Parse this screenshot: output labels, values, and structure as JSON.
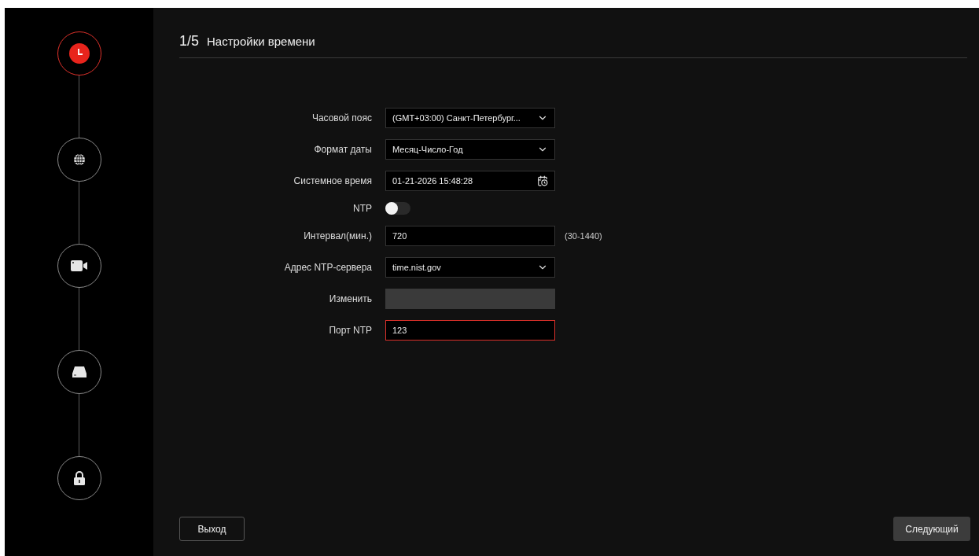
{
  "steps": [
    {
      "selected": true
    },
    {
      "selected": false
    },
    {
      "selected": false
    },
    {
      "selected": false
    },
    {
      "selected": false
    }
  ],
  "header": {
    "step": "1/5",
    "title": "Настройки времени"
  },
  "form": [
    {
      "label": "Часовой пояс",
      "kind": "select",
      "value": "(GMT+03:00) Санкт-Петербург...",
      "focused": false
    },
    {
      "label": "Формат даты",
      "kind": "select",
      "value": "Месяц-Число-Год",
      "focused": false
    },
    {
      "label": "Системное время",
      "kind": "date",
      "value": "01-21-2026 15:48:28",
      "focused": false
    },
    {
      "label": "NTP",
      "kind": "toggle",
      "on": false
    },
    {
      "label": "Интервал(мин.)",
      "kind": "input",
      "value": "720",
      "hint": "(30-1440)",
      "focused": false
    },
    {
      "label": "Адрес NTP-сервера",
      "kind": "select",
      "value": "time.nist.gov",
      "focused": false
    },
    {
      "label": "Изменить",
      "kind": "disabled"
    },
    {
      "label": "Порт NTP",
      "kind": "input",
      "value": "123",
      "focused": true
    }
  ],
  "buttons": {
    "exit": "Выход",
    "next": "Следующий"
  }
}
